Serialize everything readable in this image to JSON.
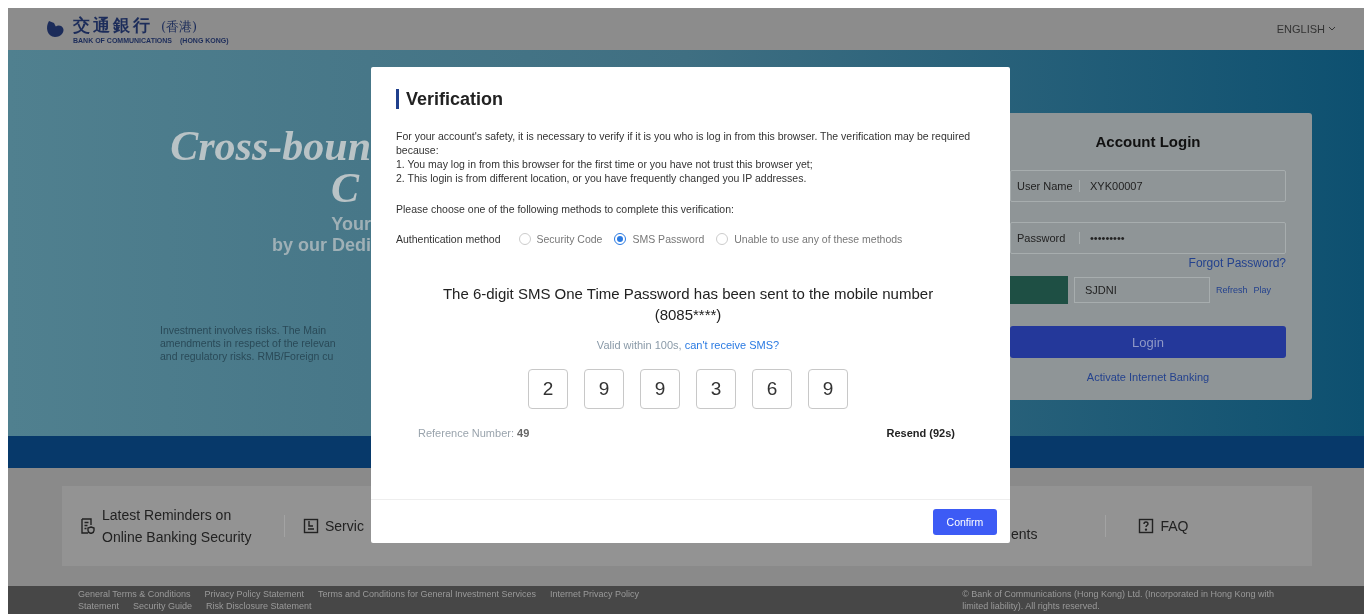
{
  "header": {
    "logo_chinese": "交通銀行",
    "logo_region": "(香港)",
    "logo_english": "BANK OF COMMUNICATIONS",
    "logo_english_region": "(HONG KONG)",
    "language": "ENGLISH"
  },
  "hero": {
    "title": "Cross-boun",
    "title_line2": "C",
    "subtitle_line1": "Your",
    "subtitle_line2": "by our Dedi",
    "disclaimer": [
      "Investment involves risks. The Main",
      "amendments in respect of the relevan",
      "and regulatory risks. RMB/Foreign cu"
    ]
  },
  "login": {
    "title": "Account Login",
    "fields": [
      {
        "label": "User Name",
        "value": "XYK00007"
      },
      {
        "label": "Password",
        "value": "•••••••••"
      }
    ],
    "forgot": "Forgot Password?",
    "captcha_value": "SJDNI",
    "refresh": "Refresh",
    "play": "Play",
    "button": "Login",
    "activate": "Activate Internet Banking"
  },
  "quick_links": {
    "left": [
      {
        "kind": "reminder",
        "label": "Latest Reminders on Online Banking Security"
      },
      {
        "kind": "service",
        "label": "Servic"
      }
    ],
    "right": [
      {
        "kind": "plain",
        "label": "ents"
      },
      {
        "kind": "faq",
        "label": "FAQ"
      }
    ]
  },
  "footer": {
    "links": [
      "General Terms & Conditions",
      "Privacy Policy Statement",
      "Terms and Conditions for General Investment Services",
      "Internet Privacy Policy"
    ],
    "links_line2": [
      "Statement",
      "Security Guide",
      "Risk Disclosure Statement"
    ],
    "copyright": "© Bank of Communications (Hong Kong) Ltd. (Incorporated in Hong Kong with",
    "copyright_line2": "limited liability). All rights reserved."
  },
  "dialog": {
    "title": "Verification",
    "intro": "For your account's safety, it is necessary to verify if it is you who is log in from this browser. The verification may be required because:",
    "reasons": [
      "1. You may log in from this browser for the first time or you have not trust this browser yet;",
      "2. This login is from different location, or you have frequently changed you IP addresses."
    ],
    "prompt": "Please choose one of the following methods to complete this verification:",
    "method_label": "Authentication method",
    "methods": [
      {
        "label": "Security Code",
        "selected": false
      },
      {
        "label": "SMS Password",
        "selected": true
      },
      {
        "label": "Unable to use any of these methods",
        "selected": false
      }
    ],
    "message": "The 6-digit SMS One Time Password has been sent to the mobile number (8085****)",
    "validity": "Valid within 100s,",
    "help_link": "can't receive SMS?",
    "digits": [
      "2",
      "9",
      "9",
      "3",
      "6",
      "9"
    ],
    "reference": "Reference Number: **49**",
    "resend": "Resend (92s)",
    "confirm": "Confirm"
  }
}
